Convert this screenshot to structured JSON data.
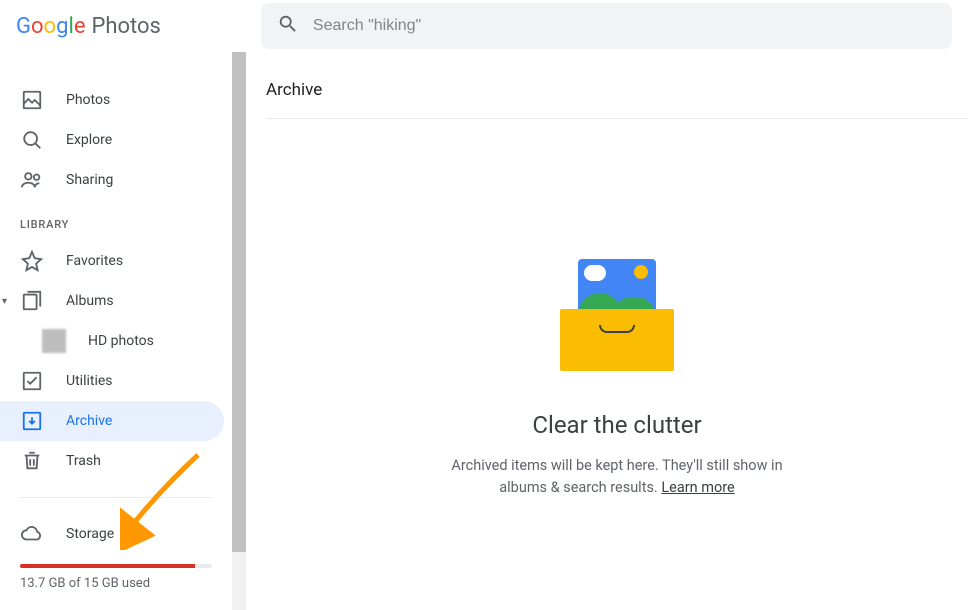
{
  "logo": {
    "product": "Photos"
  },
  "search": {
    "placeholder": "Search \"hiking\""
  },
  "nav": {
    "top": [
      {
        "label": "Photos"
      },
      {
        "label": "Explore"
      },
      {
        "label": "Sharing"
      }
    ],
    "library_header": "LIBRARY",
    "library": [
      {
        "label": "Favorites"
      },
      {
        "label": "Albums"
      },
      {
        "label": "Utilities"
      },
      {
        "label": "Archive"
      },
      {
        "label": "Trash"
      }
    ],
    "album_sub": {
      "label": "HD photos"
    },
    "storage": {
      "label": "Storage",
      "used_text": "13.7 GB of 15 GB used",
      "percent": 91
    }
  },
  "main": {
    "title": "Archive",
    "empty": {
      "heading": "Clear the clutter",
      "line1": "Archived items will be kept here. They'll still show in",
      "line2": "albums & search results. ",
      "learn_more": "Learn more"
    }
  }
}
